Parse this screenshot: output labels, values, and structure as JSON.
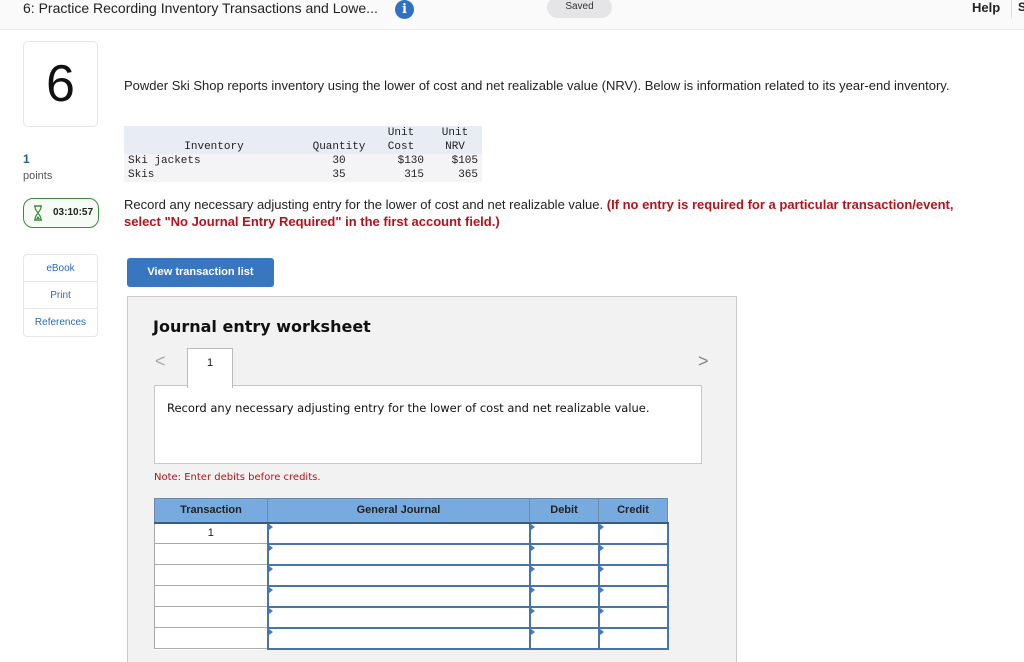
{
  "header": {
    "title": "6: Practice Recording Inventory Transactions and Lowe...",
    "info_icon": "info-icon",
    "saved_label": "Saved",
    "help_label": "Help",
    "more_label": "S"
  },
  "question": {
    "number": "6",
    "points_value": "1",
    "points_label": "points",
    "timer_icon": "hourglass-icon",
    "timer": "03:10:57"
  },
  "sidebar": {
    "links": [
      {
        "label": "eBook"
      },
      {
        "label": "Print"
      },
      {
        "label": "References"
      }
    ]
  },
  "main": {
    "intro": "Powder Ski Shop reports inventory using the lower of cost and net realizable value (NRV). Below is information related to its year-end inventory.",
    "inventory_table": {
      "headers": {
        "inventory": "Inventory",
        "quantity": "Quantity",
        "unit_cost_top": "Unit",
        "unit_cost_bottom": "Cost",
        "unit_nrv_top": "Unit",
        "unit_nrv_bottom": "NRV"
      },
      "rows": [
        {
          "item": "Ski jackets",
          "quantity": "30",
          "unit_cost": "$130",
          "unit_nrv": "$105"
        },
        {
          "item": "Skis",
          "quantity": "35",
          "unit_cost": "315",
          "unit_nrv": "365"
        }
      ]
    },
    "instruction": "Record any necessary adjusting entry for the lower of cost and net realizable value.",
    "instruction_emphasis": "(If no entry is required for a particular transaction/event, select \"No Journal Entry Required\" in the first account field.)",
    "view_button": "View transaction list"
  },
  "worksheet": {
    "title": "Journal entry worksheet",
    "prev_icon": "chevron-left-icon",
    "next_icon": "chevron-right-icon",
    "prev_glyph": "<",
    "next_glyph": ">",
    "tab_label": "1",
    "description": "Record any necessary adjusting entry for the lower of cost and net realizable value.",
    "note": "Note: Enter debits before credits.",
    "columns": [
      "Transaction",
      "General Journal",
      "Debit",
      "Credit"
    ],
    "rows": [
      {
        "transaction": "1",
        "account": "",
        "debit": "",
        "credit": ""
      },
      {
        "transaction": "",
        "account": "",
        "debit": "",
        "credit": ""
      },
      {
        "transaction": "",
        "account": "",
        "debit": "",
        "credit": ""
      },
      {
        "transaction": "",
        "account": "",
        "debit": "",
        "credit": ""
      },
      {
        "transaction": "",
        "account": "",
        "debit": "",
        "credit": ""
      },
      {
        "transaction": "",
        "account": "",
        "debit": "",
        "credit": ""
      }
    ]
  }
}
